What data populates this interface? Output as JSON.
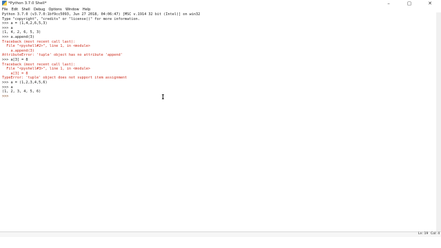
{
  "window": {
    "title": "*Python 3.7.0 Shell*",
    "controls": {
      "minimize": "–",
      "maximize": "▢",
      "close": "✕"
    }
  },
  "menu": [
    "File",
    "Edit",
    "Shell",
    "Debug",
    "Options",
    "Window",
    "Help"
  ],
  "shell": {
    "lines": [
      {
        "text": "Python 3.7.0 (v3.7.0:1bf9cc5093, Jun 27 2018, 04:06:47) [MSC v.1914 32 bit (Intel)] on win32",
        "style": "out"
      },
      {
        "text": "Type \"copyright\", \"credits\" or \"license()\" for more information.",
        "style": "out"
      },
      {
        "text": ">>> a = (1,4,2,6,5,3)",
        "style": "out"
      },
      {
        "text": ">>> a",
        "style": "out"
      },
      {
        "text": "(1, 4, 2, 6, 5, 3)",
        "style": "out"
      },
      {
        "text": ">>> a.append(3)",
        "style": "out"
      },
      {
        "text": "Traceback (most recent call last):",
        "style": "err"
      },
      {
        "text": "  File \"<pyshell#2>\", line 1, in <module>",
        "style": "err"
      },
      {
        "text": "    a.append(3)",
        "style": "err"
      },
      {
        "text": "AttributeError: 'tuple' object has no attribute 'append'",
        "style": "err"
      },
      {
        "text": ">>> a[3] = 8",
        "style": "out"
      },
      {
        "text": "Traceback (most recent call last):",
        "style": "err"
      },
      {
        "text": "  File \"<pyshell#3>\", line 1, in <module>",
        "style": "err"
      },
      {
        "text": "    a[3] = 8",
        "style": "err"
      },
      {
        "text": "TypeError: 'tuple' object does not support item assignment",
        "style": "err"
      },
      {
        "text": ">>> a = (1,2,3,4,5,6)",
        "style": "out"
      },
      {
        "text": ">>> a",
        "style": "out"
      },
      {
        "text": "(1, 2, 3, 4, 5, 6)",
        "style": "out"
      },
      {
        "text": ">>> ",
        "style": "prompt"
      }
    ]
  },
  "status": {
    "line": "Ln: 19",
    "col": "Col: 4"
  }
}
